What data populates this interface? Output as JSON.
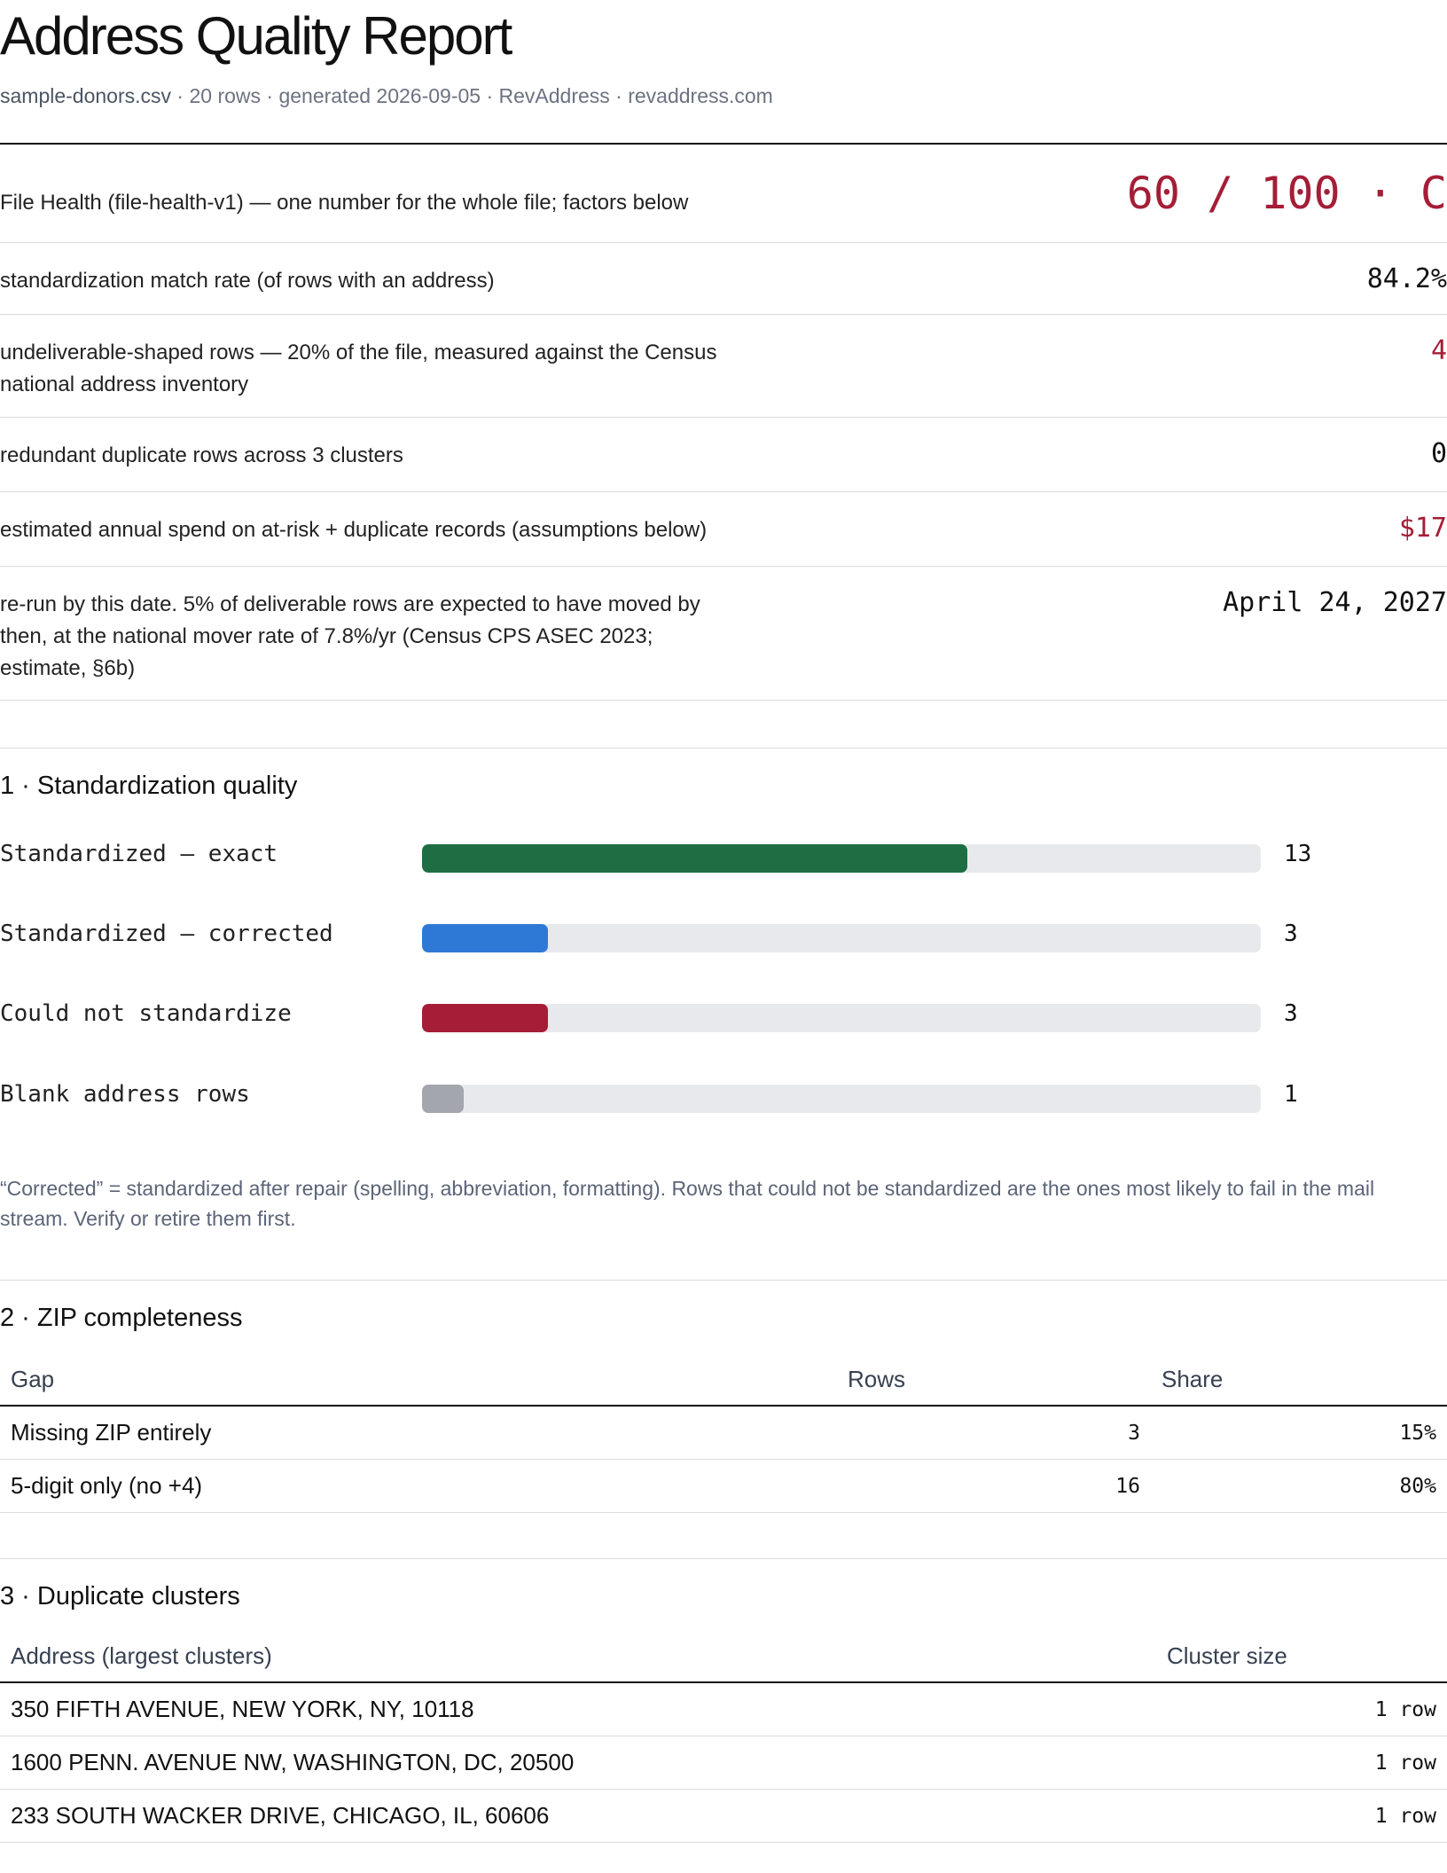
{
  "header": {
    "title": "Address Quality Report",
    "file_name": "sample-donors.csv",
    "meta": " · 20 rows · generated 2026-09-05 · RevAddress · revaddress.com"
  },
  "kpis": {
    "health_label": "File Health (file-health-v1) — one number for the whole file; factors below",
    "health_value": "60 / 100 · C",
    "match_label": "standardization match rate (of rows with an address)",
    "match_value": "84.2%",
    "undeliverable_label": "undeliverable-shaped rows — 20% of the file, measured against the Census national address inventory",
    "undeliverable_value": "4",
    "duplicate_label": "redundant duplicate rows across 3 clusters",
    "duplicate_value": "0",
    "spend_label": "estimated annual spend on at-risk + duplicate records (assumptions below)",
    "spend_value": "$17",
    "rerun_label": "re-run by this date. 5% of deliverable rows are expected to have moved by then, at the national mover rate of 7.8%/yr (Census CPS ASEC 2023; estimate, §6b)",
    "rerun_value": "April 24, 2027"
  },
  "section1": {
    "title": "1 · Standardization quality",
    "max_rows": 20,
    "bars": [
      {
        "label": "Standardized — exact",
        "value": 13,
        "color": "#1f6e43"
      },
      {
        "label": "Standardized — corrected",
        "value": 3,
        "color": "#2f79d6"
      },
      {
        "label": "Could not standardize",
        "value": 3,
        "color": "#a51d36"
      },
      {
        "label": "Blank address rows",
        "value": 1,
        "color": "#a3a6ad"
      }
    ],
    "note": "“Corrected” = standardized after repair (spelling, abbreviation, formatting). Rows that could not be standardized are the ones most likely to fail in the mail stream. Verify or retire them first."
  },
  "section2": {
    "title": "2 · ZIP completeness",
    "headers": {
      "gap": "Gap",
      "rows": "Rows",
      "share": "Share"
    },
    "rows": [
      {
        "gap": "Missing ZIP entirely",
        "rows": "3",
        "share": "15%"
      },
      {
        "gap": "5-digit only (no +4)",
        "rows": "16",
        "share": "80%"
      }
    ]
  },
  "section3": {
    "title": "3 · Duplicate clusters",
    "headers": {
      "address": "Address (largest clusters)",
      "size": "Cluster size"
    },
    "rows": [
      {
        "address": "350 FIFTH AVENUE, NEW YORK, NY, 10118",
        "size": "1 row"
      },
      {
        "address": "1600 PENN. AVENUE NW, WASHINGTON, DC, 20500",
        "size": "1 row"
      },
      {
        "address": "233 SOUTH WACKER DRIVE, CHICAGO, IL, 60606",
        "size": "1 row"
      }
    ]
  }
}
